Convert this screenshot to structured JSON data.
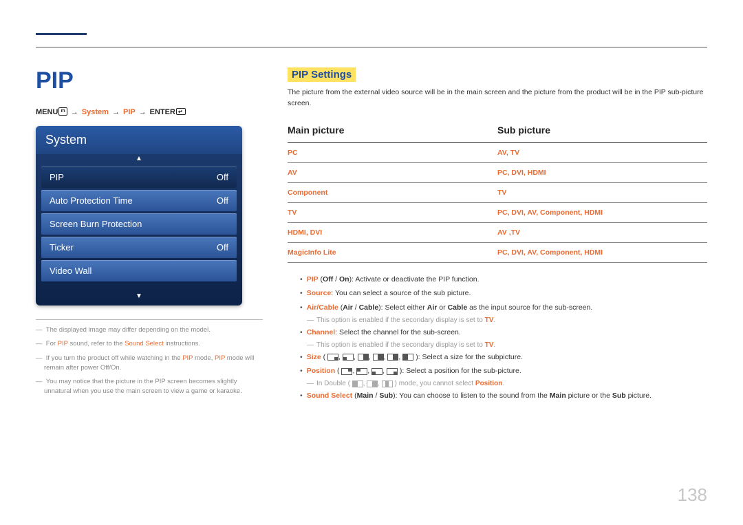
{
  "page": {
    "number": "138",
    "title": "PIP"
  },
  "breadcrumb": {
    "menu": "MENU",
    "arrow": "→",
    "system": "System",
    "pip": "PIP",
    "enter": "ENTER"
  },
  "osd": {
    "header": "System",
    "items": [
      {
        "label": "PIP",
        "value": "Off",
        "selected": true
      },
      {
        "label": "Auto Protection Time",
        "value": "Off",
        "selected": false
      },
      {
        "label": "Screen Burn Protection",
        "value": "",
        "selected": false
      },
      {
        "label": "Ticker",
        "value": "Off",
        "selected": false
      },
      {
        "label": "Video Wall",
        "value": "",
        "selected": false
      }
    ]
  },
  "footnotes": {
    "f1": "The displayed image may differ depending on the model.",
    "f2_a": "For ",
    "f2_b": "PIP",
    "f2_c": " sound, refer to the ",
    "f2_d": "Sound Select",
    "f2_e": " instructions.",
    "f3_a": "If you turn the product off while watching in the ",
    "f3_b": "PIP",
    "f3_c": " mode, ",
    "f3_d": "PIP",
    "f3_e": " mode will remain after power Off/On.",
    "f4": "You may notice that the picture in the PIP screen becomes slightly unnatural when you use the main screen to view a game or karaoke."
  },
  "right": {
    "section_title": "PIP Settings",
    "intro": "The picture from the external video source will be in the main screen and the picture from the product will be in the PIP sub-picture screen.",
    "table": {
      "col1": "Main picture",
      "col2": "Sub picture",
      "rows": [
        {
          "main": "PC",
          "sub": "AV, TV"
        },
        {
          "main": "AV",
          "sub": "PC, DVI, HDMI"
        },
        {
          "main": "Component",
          "sub": "TV"
        },
        {
          "main": "TV",
          "sub": "PC, DVI, AV, Component, HDMI"
        },
        {
          "main": "HDMI, DVI",
          "sub": "AV ,TV"
        },
        {
          "main": "MagicInfo Lite",
          "sub": "PC, DVI, AV, Component, HDMI"
        }
      ]
    },
    "bullets": {
      "b1_a": "PIP",
      "b1_b": " (",
      "b1_c": "Off",
      "b1_d": " / ",
      "b1_e": "On",
      "b1_f": "): Activate or deactivate the PIP function.",
      "b2_a": "Source",
      "b2_b": ": You can select a source of the sub picture.",
      "b3_a": "Air/Cable",
      "b3_b": " (",
      "b3_c": "Air",
      "b3_d": " / ",
      "b3_e": "Cable",
      "b3_f": "): Select either ",
      "b3_g": "Air",
      "b3_h": " or ",
      "b3_i": "Cable",
      "b3_j": " as the input source for the sub-screen.",
      "s3_a": "This option is enabled if the secondary display is set to ",
      "s3_b": "TV",
      "s3_c": ".",
      "b4_a": "Channel",
      "b4_b": ": Select the channel for the sub-screen.",
      "s4_a": "This option is enabled if the secondary display is set to ",
      "s4_b": "TV",
      "s4_c": ".",
      "b5_a": "Size",
      "b5_b": " (",
      "b5_c": "): Select a size for the subpicture.",
      "b6_a": "Position",
      "b6_b": " (",
      "b6_c": "): Select a position for the sub-picture.",
      "s6_a": "In Double (",
      "s6_b": ") mode, you cannot select ",
      "s6_c": "Position",
      "s6_d": ".",
      "b7_a": "Sound Select",
      "b7_b": " (",
      "b7_c": "Main",
      "b7_d": " / ",
      "b7_e": "Sub",
      "b7_f": "): You can choose to listen to the sound from the ",
      "b7_g": "Main",
      "b7_h": " picture or the ",
      "b7_i": "Sub",
      "b7_j": " picture."
    }
  }
}
